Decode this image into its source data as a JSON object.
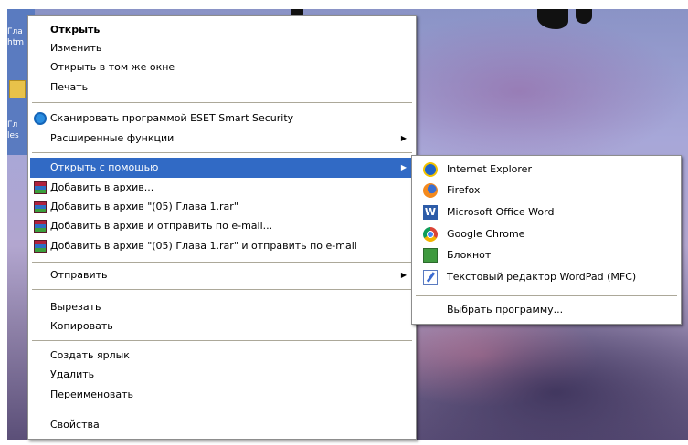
{
  "desktop": {
    "icon_labels": [
      "Гла",
      "htm",
      "Гл",
      "les"
    ]
  },
  "main_menu": {
    "items": [
      {
        "label": "Открыть",
        "bold": true
      },
      {
        "label": "Изменить"
      },
      {
        "label": "Открыть в том же окне"
      },
      {
        "label": "Печать"
      },
      {
        "label": "Сканировать программой ESET Smart Security",
        "icon": "eset-icon"
      },
      {
        "label": "Расширенные функции",
        "submenu": true
      },
      {
        "label": "Открыть с помощью",
        "submenu": true,
        "highlighted": true
      },
      {
        "label": "Добавить в архив...",
        "icon": "winrar-icon"
      },
      {
        "label": "Добавить в архив \"(05) Глава 1.rar\"",
        "icon": "winrar-icon"
      },
      {
        "label": "Добавить в архив и отправить по e-mail...",
        "icon": "winrar-icon"
      },
      {
        "label": "Добавить в архив \"(05) Глава 1.rar\" и отправить по e-mail",
        "icon": "winrar-icon"
      },
      {
        "label": "Отправить",
        "submenu": true
      },
      {
        "label": "Вырезать"
      },
      {
        "label": "Копировать"
      },
      {
        "label": "Создать ярлык"
      },
      {
        "label": "Удалить"
      },
      {
        "label": "Переименовать"
      },
      {
        "label": "Свойства"
      }
    ],
    "submenu_arrow": "▶"
  },
  "open_with_menu": {
    "items": [
      {
        "label": "Internet Explorer",
        "icon": "internet-explorer-icon"
      },
      {
        "label": "Firefox",
        "icon": "firefox-icon"
      },
      {
        "label": "Microsoft Office Word",
        "icon": "word-icon"
      },
      {
        "label": "Google Chrome",
        "icon": "chrome-icon"
      },
      {
        "label": "Блокнот",
        "icon": "notepad-icon"
      },
      {
        "label": "Текстовый редактор WordPad (MFC)",
        "icon": "wordpad-icon"
      },
      {
        "label": "Выбрать программу..."
      }
    ]
  },
  "colors": {
    "highlight": "#316ac5",
    "menu_background": "#ffffff",
    "separator": "#aca899"
  }
}
